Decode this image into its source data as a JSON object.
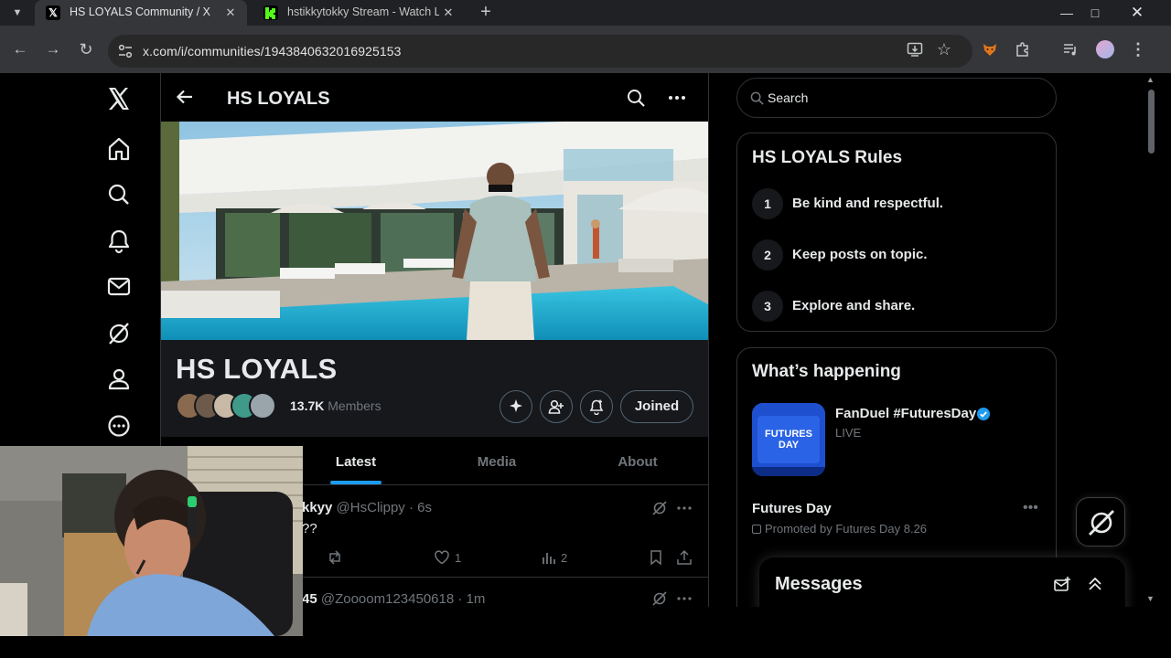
{
  "browser": {
    "tabs": [
      {
        "title": "HS LOYALS Community / X",
        "active": true,
        "favicon": "x-logo"
      },
      {
        "title": "hstikkytokky Stream - Watch Li",
        "active": false,
        "favicon": "kick-logo"
      }
    ],
    "url": "x.com/i/communities/1943840632016925153",
    "colors": {
      "chrome_dark": "#202124",
      "toolbar": "#35363a",
      "kick_green": "#53fc18"
    }
  },
  "nav": {
    "items": [
      "x-logo",
      "home-icon",
      "explore-icon",
      "notifications-icon",
      "messages-icon",
      "grok-icon",
      "profile-icon",
      "more-icon"
    ]
  },
  "header": {
    "title": "HS LOYALS"
  },
  "community": {
    "name": "HS LOYALS",
    "member_count": "13.7K",
    "members_label": "Members",
    "joined_label": "Joined"
  },
  "tabs": {
    "latest": "Latest",
    "media": "Media",
    "about": "About",
    "selected": "Latest"
  },
  "posts": [
    {
      "name": "kkyy",
      "handle": "@HsClippy",
      "time": "· 6s",
      "text": "??",
      "likes": "1",
      "views": "2"
    },
    {
      "name": "45",
      "handle": "@Zoooom123450618",
      "time": "· 1m"
    }
  ],
  "search": {
    "placeholder": "Search"
  },
  "rules": {
    "title": "HS LOYALS Rules",
    "items": [
      {
        "num": "1",
        "text": "Be kind and respectful."
      },
      {
        "num": "2",
        "text": "Keep posts on topic."
      },
      {
        "num": "3",
        "text": "Explore and share."
      }
    ]
  },
  "happening": {
    "title": "What’s happening",
    "trend_title": "FanDuel #FuturesDay",
    "trend_status": "LIVE",
    "thumb_text": "FUTURES DAY",
    "promo_title": "Futures Day",
    "promo_sub": "Promoted by Futures Day 8.26"
  },
  "messages": {
    "title": "Messages"
  },
  "colors": {
    "accent": "#1d9bf0",
    "text": "#e7e9ea",
    "muted": "#71767b",
    "border": "#2f3336"
  }
}
